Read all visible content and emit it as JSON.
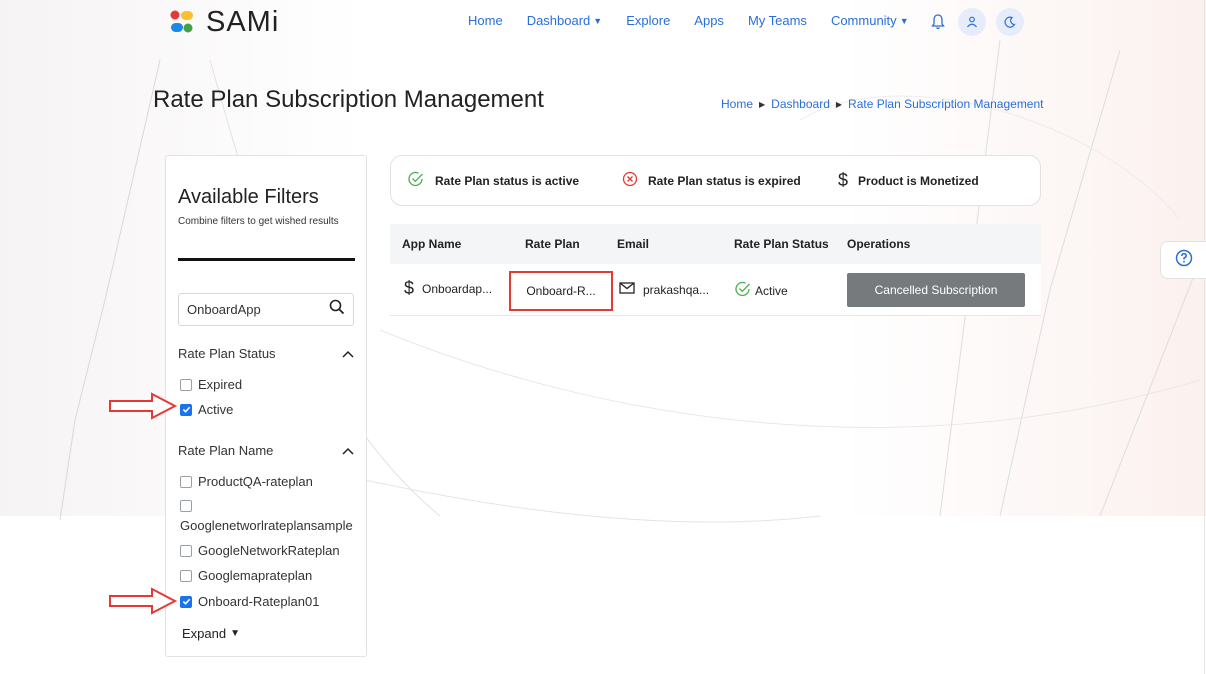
{
  "app": {
    "name": "SAMi"
  },
  "nav": {
    "items": [
      {
        "label": "Home",
        "dropdown": false
      },
      {
        "label": "Dashboard",
        "dropdown": true
      },
      {
        "label": "Explore",
        "dropdown": false
      },
      {
        "label": "Apps",
        "dropdown": false
      },
      {
        "label": "My Teams",
        "dropdown": false
      },
      {
        "label": "Community",
        "dropdown": true
      }
    ],
    "icons": [
      "bell-icon",
      "user-icon",
      "moon-icon"
    ]
  },
  "page": {
    "title": "Rate Plan Subscription Management",
    "breadcrumb": [
      "Home",
      "Dashboard",
      "Rate Plan Subscription Management"
    ]
  },
  "filters": {
    "title": "Available Filters",
    "subtitle": "Combine filters to get wished results",
    "search_value": "OnboardApp",
    "status_section": {
      "label": "Rate Plan Status",
      "options": [
        {
          "label": "Expired",
          "checked": false
        },
        {
          "label": "Active",
          "checked": true
        }
      ]
    },
    "name_section": {
      "label": "Rate Plan Name",
      "options": [
        {
          "label": "ProductQA-rateplan",
          "checked": false
        },
        {
          "label": "Googlenetworlrateplansample",
          "checked": false
        },
        {
          "label": "GoogleNetworkRateplan",
          "checked": false
        },
        {
          "label": "Googlemaprateplan",
          "checked": false
        },
        {
          "label": "Onboard-Rateplan01",
          "checked": true
        }
      ]
    },
    "expand_label": "Expand"
  },
  "legend": {
    "active": "Rate Plan status is active",
    "expired": "Rate Plan status is expired",
    "monetized": "Product is Monetized"
  },
  "table": {
    "headers": [
      "App Name",
      "Rate Plan",
      "Email",
      "Rate Plan Status",
      "Operations"
    ],
    "rows": [
      {
        "app_name": "Onboardap...",
        "rate_plan": "Onboard-R...",
        "email": "prakashqa...",
        "status": "Active",
        "operation": "Cancelled Subscription"
      }
    ]
  },
  "colors": {
    "link": "#2a6fd8",
    "active_green": "#4caf50",
    "expired_red": "#e53935",
    "button_gray": "#777a7d",
    "highlight_red": "#e53935",
    "checkbox_blue": "#1a73e8"
  }
}
